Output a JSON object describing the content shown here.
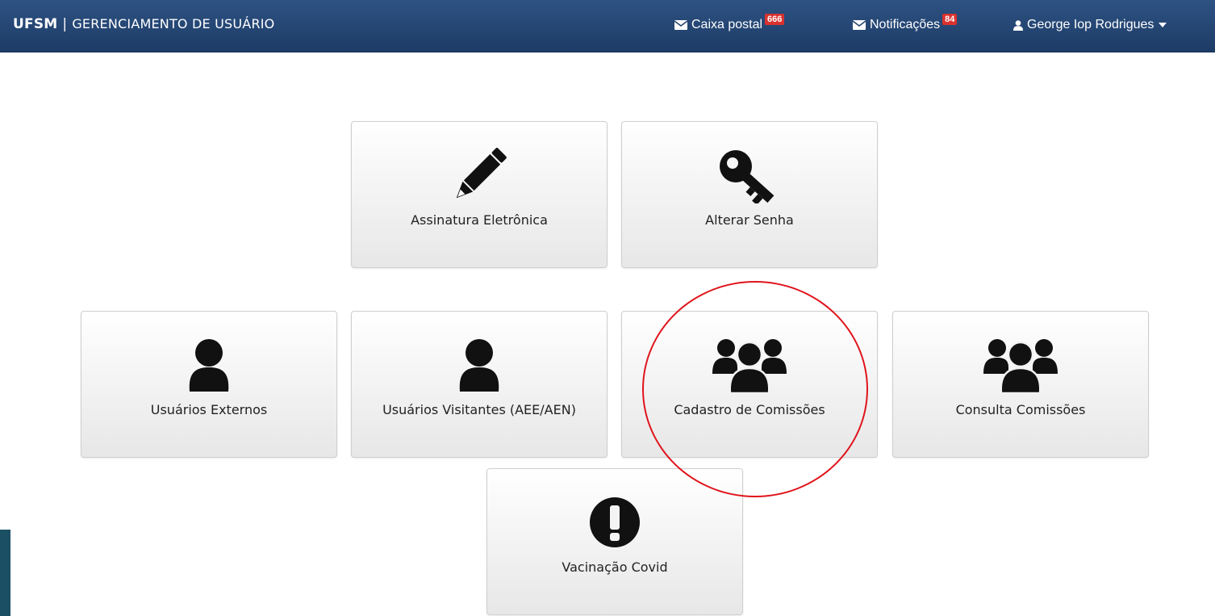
{
  "header": {
    "brand": "UFSM",
    "separator": "|",
    "subtitle": "GERENCIAMENTO DE USUÁRIO",
    "mailbox": {
      "label": "Caixa postal",
      "count": "666",
      "icon": "envelope-icon"
    },
    "notifications": {
      "label": "Notificações",
      "count": "84",
      "icon": "envelope-icon"
    },
    "user": {
      "name": "George Iop Rodrigues",
      "icon": "user-icon"
    }
  },
  "tiles": [
    {
      "label": "Assinatura Eletrônica",
      "icon": "pencil-icon"
    },
    {
      "label": "Alterar Senha",
      "icon": "key-icon"
    },
    {
      "label": "Usuários Externos",
      "icon": "user-icon"
    },
    {
      "label": "Usuários Visitantes (AEE/AEN)",
      "icon": "user-icon"
    },
    {
      "label": "Cadastro de Comissões",
      "icon": "users-icon"
    },
    {
      "label": "Consulta Comissões",
      "icon": "users-icon"
    },
    {
      "label": "Vacinação Covid",
      "icon": "exclamation-circle-icon"
    }
  ],
  "colors": {
    "navbar": "#25476f",
    "badge": "#d9322f",
    "highlight_circle": "#e0141b"
  }
}
